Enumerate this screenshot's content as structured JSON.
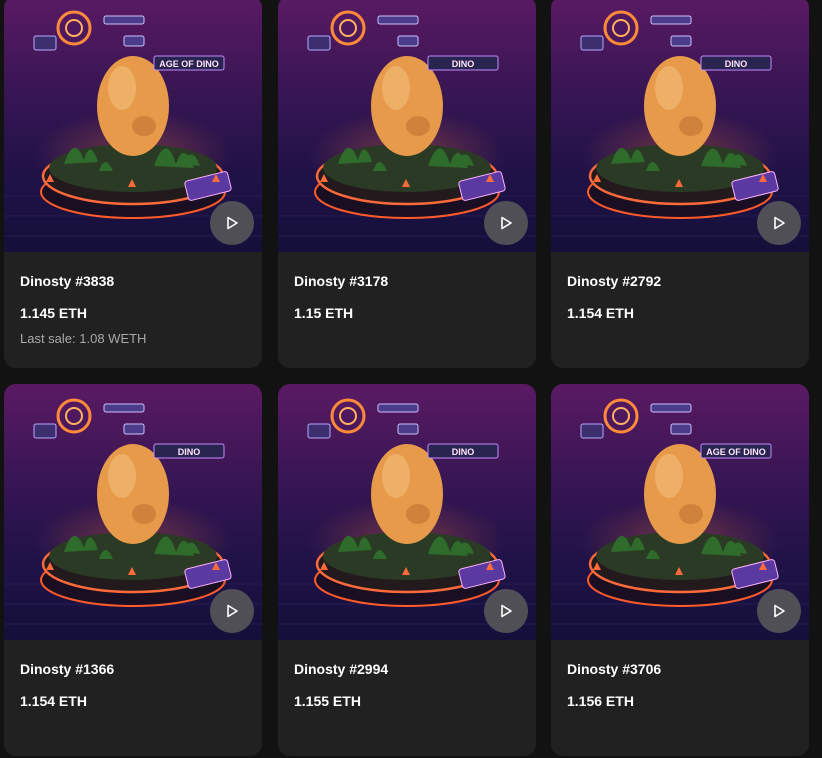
{
  "colors": {
    "page_bg": "#121212",
    "card_bg": "#212121",
    "text_primary": "#ffffff",
    "text_secondary": "#a8a8a8",
    "play_button_bg": "#5a5a5a"
  },
  "cards": [
    {
      "name": "Dinosty #3838",
      "price": "1.145 ETH",
      "last_sale": "Last sale: 1.08 WETH",
      "egg_label": "AGE OF DINO"
    },
    {
      "name": "Dinosty #3178",
      "price": "1.15 ETH",
      "last_sale": "",
      "egg_label": "DINO"
    },
    {
      "name": "Dinosty #2792",
      "price": "1.154 ETH",
      "last_sale": "",
      "egg_label": "DINO"
    },
    {
      "name": "Dinosty #1366",
      "price": "1.154 ETH",
      "last_sale": "",
      "egg_label": "DINO"
    },
    {
      "name": "Dinosty #2994",
      "price": "1.155 ETH",
      "last_sale": "",
      "egg_label": "DINO"
    },
    {
      "name": "Dinosty #3706",
      "price": "1.156 ETH",
      "last_sale": "",
      "egg_label": "AGE OF DINO"
    }
  ],
  "icons": {
    "play": "play-icon"
  }
}
